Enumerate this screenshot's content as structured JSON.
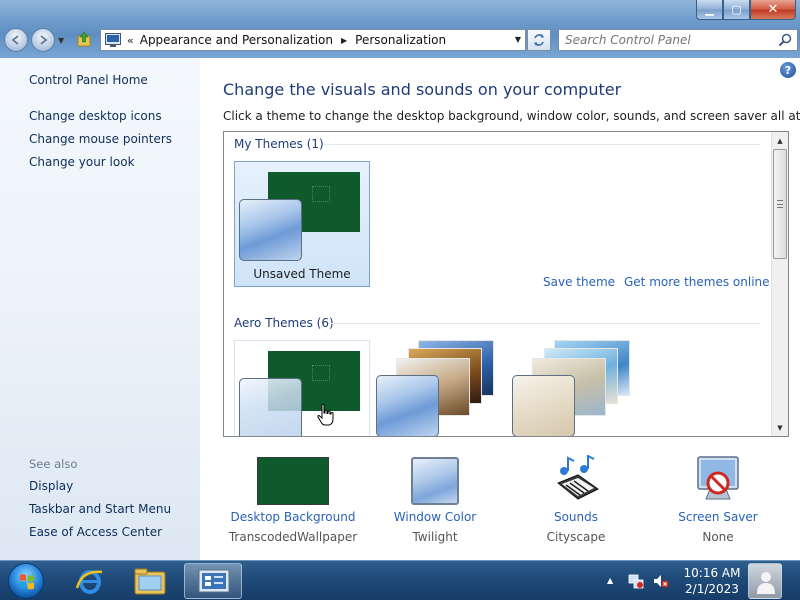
{
  "window": {
    "caption_min": "▁",
    "caption_max": "▢",
    "caption_close": "✕"
  },
  "address": {
    "chevron": "«",
    "crumbs": [
      "Appearance and Personalization",
      "Personalization"
    ]
  },
  "search": {
    "placeholder": "Search Control Panel"
  },
  "sidebar": {
    "home": "Control Panel Home",
    "tasks": [
      "Change desktop icons",
      "Change mouse pointers",
      "Change your look"
    ],
    "see_also_label": "See also",
    "see_also": [
      "Display",
      "Taskbar and Start Menu",
      "Ease of Access Center"
    ]
  },
  "main": {
    "help": "?",
    "title": "Change the visuals and sounds on your computer",
    "description": "Click a theme to change the desktop background, window color, sounds, and screen saver all at once.",
    "my_themes_header": "My Themes (1)",
    "unsaved_theme_label": "Unsaved Theme",
    "save_theme_link": "Save theme",
    "more_themes_link": "Get more themes online",
    "aero_themes_header": "Aero Themes (6)"
  },
  "bottom": [
    {
      "label": "Desktop Background",
      "value": "TranscodedWallpaper"
    },
    {
      "label": "Window Color",
      "value": "Twilight"
    },
    {
      "label": "Sounds",
      "value": "Cityscape"
    },
    {
      "label": "Screen Saver",
      "value": "None"
    }
  ],
  "taskbar": {
    "time": "10:16 AM",
    "date": "2/1/2023"
  },
  "colors": {
    "link": "#2a62b8",
    "title": "#1e3c78",
    "wallpaper_green": "#0f5a2c"
  }
}
